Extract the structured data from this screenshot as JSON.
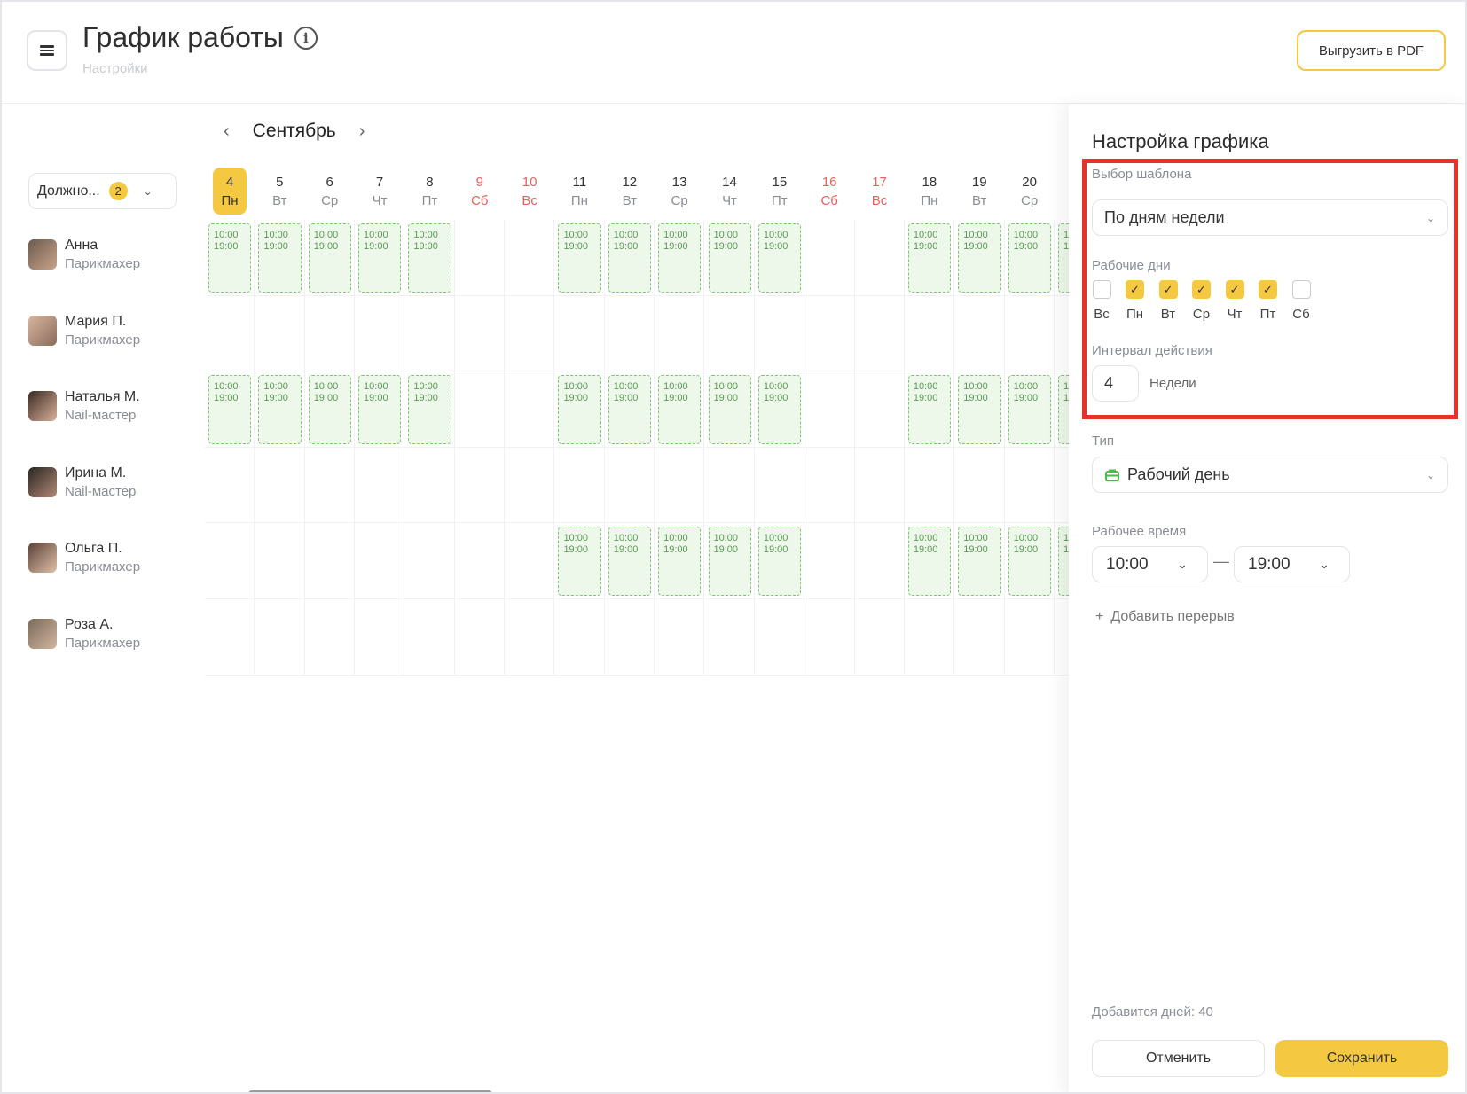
{
  "header": {
    "title": "График работы",
    "subtitle": "Настройки",
    "export_label": "Выгрузить в PDF"
  },
  "calendar": {
    "month": "Сентябрь",
    "filter": {
      "label": "Должно...",
      "count": "2"
    },
    "shift_start": "10:00",
    "shift_end": "19:00",
    "days": [
      {
        "n": "4",
        "wd": "Пн",
        "weekend": false,
        "today": true
      },
      {
        "n": "5",
        "wd": "Вт",
        "weekend": false
      },
      {
        "n": "6",
        "wd": "Ср",
        "weekend": false
      },
      {
        "n": "7",
        "wd": "Чт",
        "weekend": false
      },
      {
        "n": "8",
        "wd": "Пт",
        "weekend": false
      },
      {
        "n": "9",
        "wd": "Сб",
        "weekend": true
      },
      {
        "n": "10",
        "wd": "Вс",
        "weekend": true
      },
      {
        "n": "11",
        "wd": "Пн",
        "weekend": false
      },
      {
        "n": "12",
        "wd": "Вт",
        "weekend": false
      },
      {
        "n": "13",
        "wd": "Ср",
        "weekend": false
      },
      {
        "n": "14",
        "wd": "Чт",
        "weekend": false
      },
      {
        "n": "15",
        "wd": "Пт",
        "weekend": false
      },
      {
        "n": "16",
        "wd": "Сб",
        "weekend": true
      },
      {
        "n": "17",
        "wd": "Вс",
        "weekend": true
      },
      {
        "n": "18",
        "wd": "Пн",
        "weekend": false
      },
      {
        "n": "19",
        "wd": "Вт",
        "weekend": false
      },
      {
        "n": "20",
        "wd": "Ср",
        "weekend": false
      }
    ],
    "employees": [
      {
        "name": "Анна",
        "role": "Парикмахер",
        "shifts": [
          "4",
          "5",
          "6",
          "7",
          "8",
          "11",
          "12",
          "13",
          "14",
          "15",
          "18",
          "19",
          "20"
        ],
        "shift_continues": true
      },
      {
        "name": "Мария П.",
        "role": "Парикмахер",
        "shifts": []
      },
      {
        "name": "Наталья М.",
        "role": "Nail-мастер",
        "shifts": [
          "4",
          "5",
          "6",
          "7",
          "8",
          "11",
          "12",
          "13",
          "14",
          "15",
          "18",
          "19",
          "20"
        ],
        "shift_continues": true
      },
      {
        "name": "Ирина М.",
        "role": "Nail-мастер",
        "shifts": []
      },
      {
        "name": "Ольга П.",
        "role": "Парикмахер",
        "shifts": [
          "11",
          "12",
          "13",
          "14",
          "15",
          "18",
          "19",
          "20"
        ],
        "shift_continues": true
      },
      {
        "name": "Роза А.",
        "role": "Парикмахер",
        "shifts": []
      }
    ]
  },
  "panel": {
    "title": "Настройка графика",
    "template_label": "Выбор шаблона",
    "template_value": "По дням недели",
    "workdays_label": "Рабочие дни",
    "workdays": [
      {
        "label": "Вс",
        "checked": false
      },
      {
        "label": "Пн",
        "checked": true
      },
      {
        "label": "Вт",
        "checked": true
      },
      {
        "label": "Ср",
        "checked": true
      },
      {
        "label": "Чт",
        "checked": true
      },
      {
        "label": "Пт",
        "checked": true
      },
      {
        "label": "Сб",
        "checked": false
      }
    ],
    "interval_label": "Интервал действия",
    "interval_value": "4",
    "interval_unit": "Недели",
    "type_label": "Тип",
    "type_value": "Рабочий день",
    "type_icon": "briefcase-icon",
    "time_label": "Рабочее время",
    "time_from": "10:00",
    "time_dash": "—",
    "time_to": "19:00",
    "add_break": "Добавить перерыв",
    "summary": "Добавится дней: 40",
    "cancel": "Отменить",
    "save": "Сохранить"
  },
  "colors": {
    "accent": "#f5c842",
    "highlight": "#e5322a",
    "shift_border": "#7cc96f",
    "shift_bg": "#edf7ea",
    "weekend": "#e8615e"
  }
}
